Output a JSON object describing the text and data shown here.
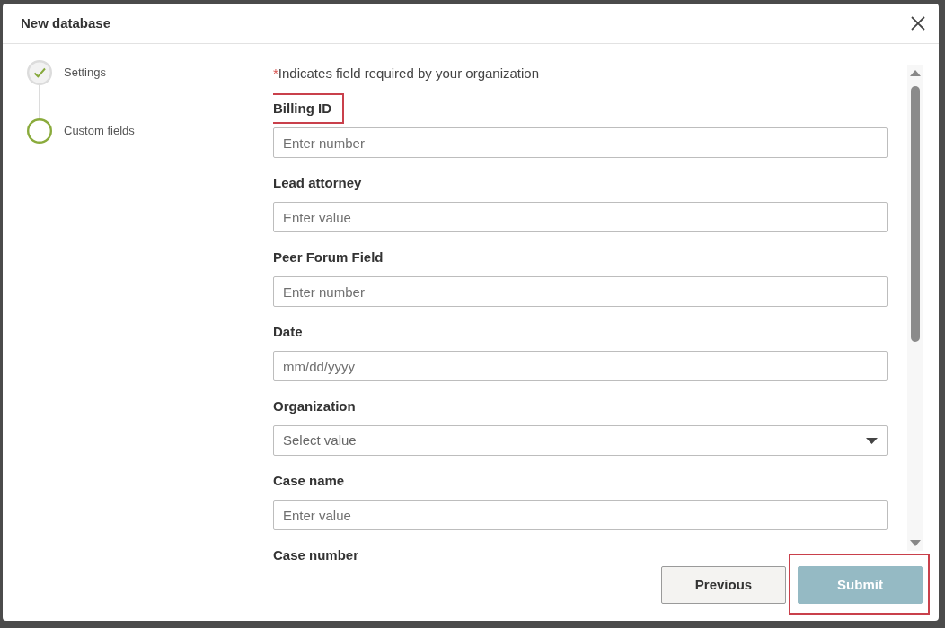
{
  "dialog": {
    "title": "New database"
  },
  "steps": [
    {
      "label": "Settings",
      "completed": true,
      "selected": false
    },
    {
      "label": "Custom fields",
      "completed": false,
      "selected": true
    }
  ],
  "required_note": {
    "mark": "*",
    "text": "Indicates field required by your organization"
  },
  "fields": [
    {
      "label": "Billing ID",
      "kind": "text",
      "placeholder": "Enter number",
      "highlighted": true
    },
    {
      "label": "Lead attorney",
      "kind": "text",
      "placeholder": "Enter value",
      "highlighted": false
    },
    {
      "label": "Peer Forum Field",
      "kind": "text",
      "placeholder": "Enter number",
      "highlighted": false
    },
    {
      "label": "Date",
      "kind": "date",
      "placeholder": "mm/dd/yyyy",
      "highlighted": false
    },
    {
      "label": "Organization",
      "kind": "select",
      "placeholder": "Select value",
      "highlighted": false
    },
    {
      "label": "Case name",
      "kind": "text",
      "placeholder": "Enter value",
      "highlighted": false
    },
    {
      "label": "Case number",
      "kind": "label_only",
      "highlighted": false
    }
  ],
  "buttons": [
    {
      "label": "Previous",
      "kind": "secondary",
      "disabled": false,
      "highlighted": false
    },
    {
      "label": "Submit",
      "kind": "primary",
      "disabled": true,
      "highlighted": true
    }
  ]
}
